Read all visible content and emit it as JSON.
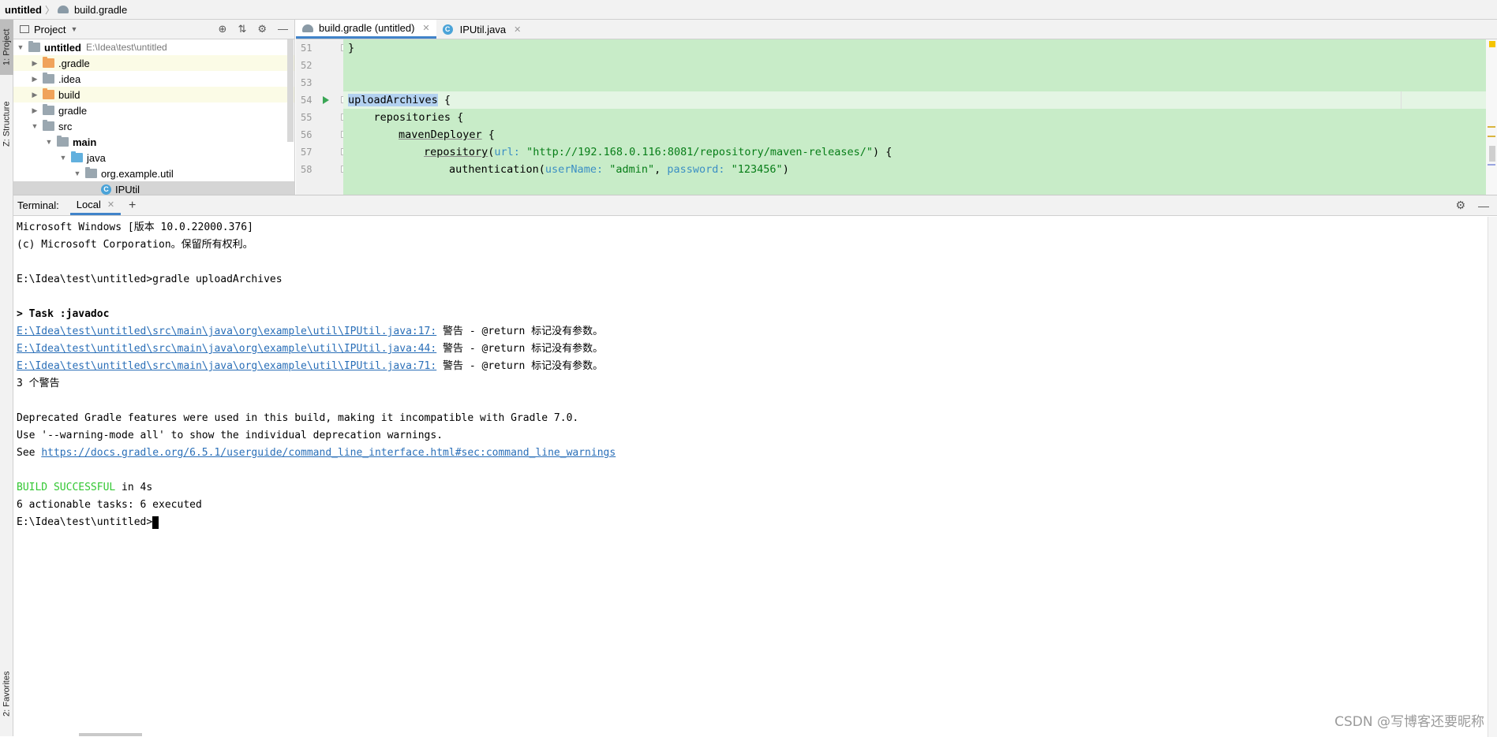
{
  "breadcrumb": {
    "project": "untitled",
    "file": "build.gradle"
  },
  "left_strip": {
    "project_tab": "1: Project",
    "structure_tab": "Z: Structure",
    "favorites_tab": "2: Favorites"
  },
  "project_pane": {
    "title": "Project",
    "tree": [
      {
        "label": "untitled",
        "path": "E:\\Idea\\test\\untitled"
      },
      {
        "label": ".gradle"
      },
      {
        "label": ".idea"
      },
      {
        "label": "build"
      },
      {
        "label": "gradle"
      },
      {
        "label": "src"
      },
      {
        "label": "main"
      },
      {
        "label": "java"
      },
      {
        "label": "org.example.util"
      },
      {
        "label": "IPUtil"
      }
    ]
  },
  "editor": {
    "tabs": [
      {
        "label": "build.gradle (untitled)"
      },
      {
        "label": "IPUtil.java"
      }
    ],
    "line_numbers": [
      "51",
      "52",
      "53",
      "54",
      "55",
      "56",
      "57",
      "58"
    ],
    "code": {
      "l51": "}",
      "l54_kw": "uploadArchives",
      "l54_rest": " {",
      "l55": "    repositories {",
      "l56_kw": "mavenDeployer",
      "l56_rest": " {",
      "l57_fn": "repository",
      "l57_p1": "(",
      "l57_param": "url: ",
      "l57_str": "\"http://192.168.0.116:8081/repository/maven-releases/\"",
      "l57_end": ") {",
      "l58_fn": "authentication(",
      "l58_param1": "userName: ",
      "l58_str1": "\"admin\"",
      "l58_sep": ", ",
      "l58_param2": "password: ",
      "l58_str2": "\"123456\"",
      "l58_end": ")"
    }
  },
  "terminal": {
    "label": "Terminal:",
    "tab": "Local",
    "add": "+",
    "lines": {
      "l1": "Microsoft Windows [版本 10.0.22000.376]",
      "l2": "(c) Microsoft Corporation。保留所有权利。",
      "l3": "E:\\Idea\\test\\untitled>gradle uploadArchives",
      "l4": "> Task :javadoc",
      "w1_link": "E:\\Idea\\test\\untitled\\src\\main\\java\\org\\example\\util\\IPUtil.java:17:",
      "w2_link": "E:\\Idea\\test\\untitled\\src\\main\\java\\org\\example\\util\\IPUtil.java:44:",
      "w3_link": "E:\\Idea\\test\\untitled\\src\\main\\java\\org\\example\\util\\IPUtil.java:71:",
      "warn_text": " 警告 - @return 标记没有参数。",
      "warn_count": "3 个警告",
      "dep1": "Deprecated Gradle features were used in this build, making it incompatible with Gradle 7.0.",
      "dep2": "Use '--warning-mode all' to show the individual deprecation warnings.",
      "see": "See ",
      "see_link": "https://docs.gradle.org/6.5.1/userguide/command_line_interface.html#sec:command_line_warnings",
      "build_ok": "BUILD SUCCESSFUL",
      "build_time": " in 4s",
      "tasks": "6 actionable tasks: 6 executed",
      "prompt": "E:\\Idea\\test\\untitled>"
    }
  },
  "watermark": "CSDN @写博客还要昵称"
}
